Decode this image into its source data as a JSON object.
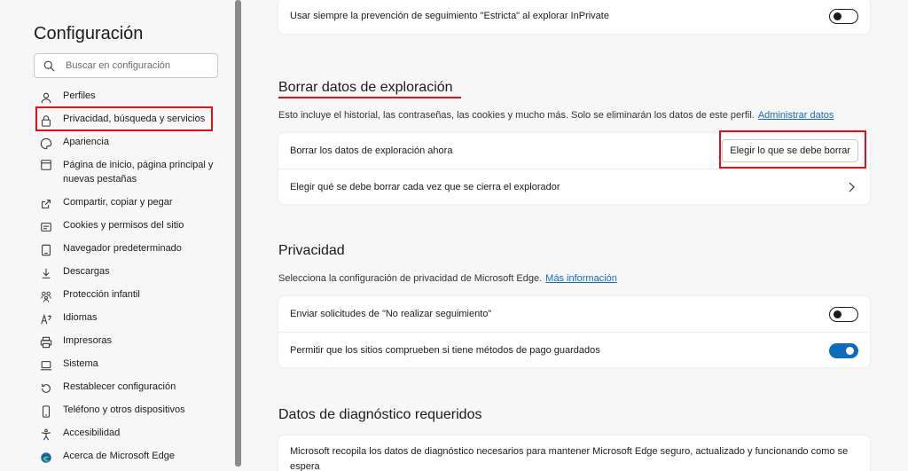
{
  "sidebar": {
    "title": "Configuración",
    "search_placeholder": "Buscar en configuración",
    "items": [
      {
        "label": "Perfiles"
      },
      {
        "label": "Privacidad, búsqueda y servicios"
      },
      {
        "label": "Apariencia"
      },
      {
        "label": "Página de inicio, página principal y nuevas pestañas"
      },
      {
        "label": "Compartir, copiar y pegar"
      },
      {
        "label": "Cookies y permisos del sitio"
      },
      {
        "label": "Navegador predeterminado"
      },
      {
        "label": "Descargas"
      },
      {
        "label": "Protección infantil"
      },
      {
        "label": "Idiomas"
      },
      {
        "label": "Impresoras"
      },
      {
        "label": "Sistema"
      },
      {
        "label": "Restablecer configuración"
      },
      {
        "label": "Teléfono y otros dispositivos"
      },
      {
        "label": "Accesibilidad"
      },
      {
        "label": "Acerca de Microsoft Edge"
      }
    ]
  },
  "top_card": {
    "strict_label": "Usar siempre la prevención de seguimiento \"Estricta\" al explorar InPrivate"
  },
  "clear_data": {
    "title": "Borrar datos de exploración",
    "desc": "Esto incluye el historial, las contraseñas, las cookies y mucho más. Solo se eliminarán los datos de este perfil.",
    "desc_link": "Administrar datos",
    "row1_label": "Borrar los datos de exploración ahora",
    "row1_button": "Elegir lo que se debe borrar",
    "row2_label": "Elegir qué se debe borrar cada vez que se cierra el explorador"
  },
  "privacy": {
    "title": "Privacidad",
    "desc": "Selecciona la configuración de privacidad de Microsoft Edge.",
    "desc_link": "Más información",
    "row1_label": "Enviar solicitudes de \"No realizar seguimiento\"",
    "row2_label": "Permitir que los sitios comprueben si tiene métodos de pago guardados"
  },
  "diagnostics": {
    "title": "Datos de diagnóstico requeridos",
    "text": "Microsoft recopila los datos de diagnóstico necesarios para mantener Microsoft Edge seguro, actualizado y funcionando como se espera"
  },
  "colors": {
    "accent": "#0f6cbd",
    "highlight": "#e3101a"
  },
  "toggles": {
    "strict_inprivate": false,
    "do_not_track": false,
    "payment_methods": true
  }
}
